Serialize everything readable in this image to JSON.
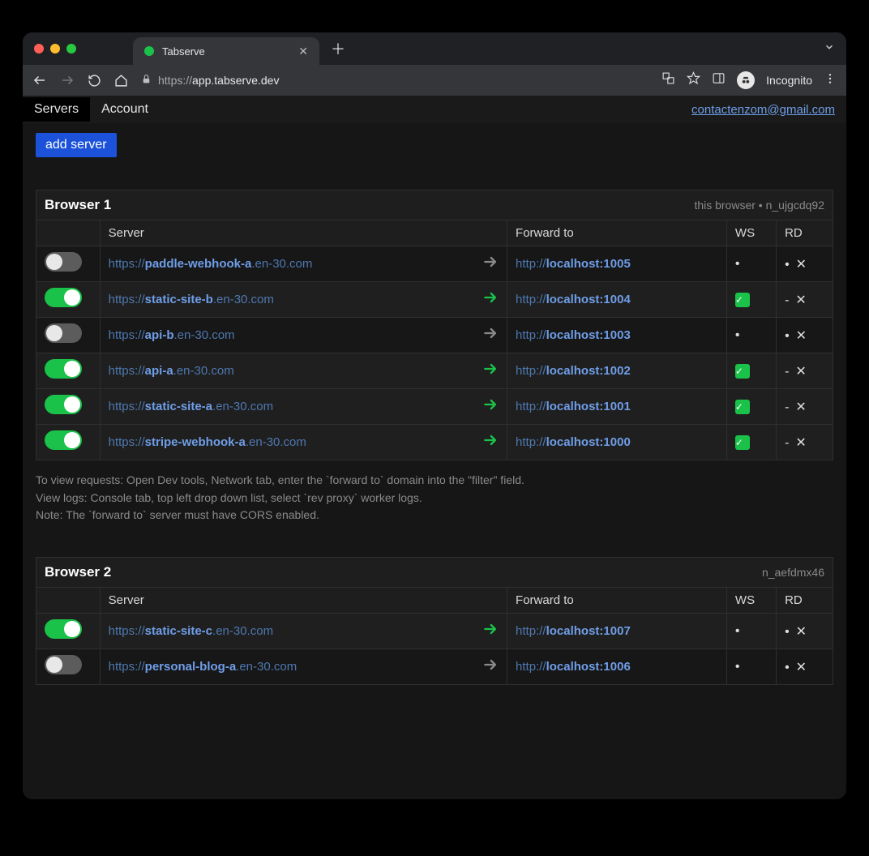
{
  "chrome": {
    "tab_title": "Tabserve",
    "url_prefix": "https://",
    "url_host": "app.tabserve.dev",
    "incognito": "Incognito"
  },
  "nav": {
    "servers": "Servers",
    "account": "Account",
    "email": "contactenzom@gmail.com"
  },
  "buttons": {
    "add_server": "add server"
  },
  "columns": {
    "server": "Server",
    "forward": "Forward to",
    "ws": "WS",
    "rd": "RD"
  },
  "browsers": [
    {
      "title": "Browser 1",
      "meta": "this browser • n_ujgcdq92",
      "rows": [
        {
          "on": false,
          "proto": "https://",
          "sub": "paddle-webhook-a",
          "domain": ".en-30.com",
          "fwd_proto": "http://",
          "fwd_host": "localhost:1005",
          "ws": "dot",
          "rd": "dot"
        },
        {
          "on": true,
          "proto": "https://",
          "sub": "static-site-b",
          "domain": ".en-30.com",
          "fwd_proto": "http://",
          "fwd_host": "localhost:1004",
          "ws": "check",
          "rd": "dash"
        },
        {
          "on": false,
          "proto": "https://",
          "sub": "api-b",
          "domain": ".en-30.com",
          "fwd_proto": "http://",
          "fwd_host": "localhost:1003",
          "ws": "dot",
          "rd": "dot"
        },
        {
          "on": true,
          "proto": "https://",
          "sub": "api-a",
          "domain": ".en-30.com",
          "fwd_proto": "http://",
          "fwd_host": "localhost:1002",
          "ws": "check",
          "rd": "dash"
        },
        {
          "on": true,
          "proto": "https://",
          "sub": "static-site-a",
          "domain": ".en-30.com",
          "fwd_proto": "http://",
          "fwd_host": "localhost:1001",
          "ws": "check",
          "rd": "dash"
        },
        {
          "on": true,
          "proto": "https://",
          "sub": "stripe-webhook-a",
          "domain": ".en-30.com",
          "fwd_proto": "http://",
          "fwd_host": "localhost:1000",
          "ws": "check",
          "rd": "dash"
        }
      ]
    },
    {
      "title": "Browser 2",
      "meta": "n_aefdmx46",
      "rows": [
        {
          "on": true,
          "proto": "https://",
          "sub": "static-site-c",
          "domain": ".en-30.com",
          "fwd_proto": "http://",
          "fwd_host": "localhost:1007",
          "ws": "dot",
          "rd": "dot"
        },
        {
          "on": false,
          "proto": "https://",
          "sub": "personal-blog-a",
          "domain": ".en-30.com",
          "fwd_proto": "http://",
          "fwd_host": "localhost:1006",
          "ws": "dot",
          "rd": "dot"
        }
      ]
    }
  ],
  "notes": {
    "l1": "To view requests: Open Dev tools, Network tab, enter the `forward to` domain into the \"filter\" field.",
    "l2": "View logs: Console tab, top left drop down list, select `rev proxy` worker logs.",
    "l3": "Note: The `forward to` server must have CORS enabled."
  }
}
